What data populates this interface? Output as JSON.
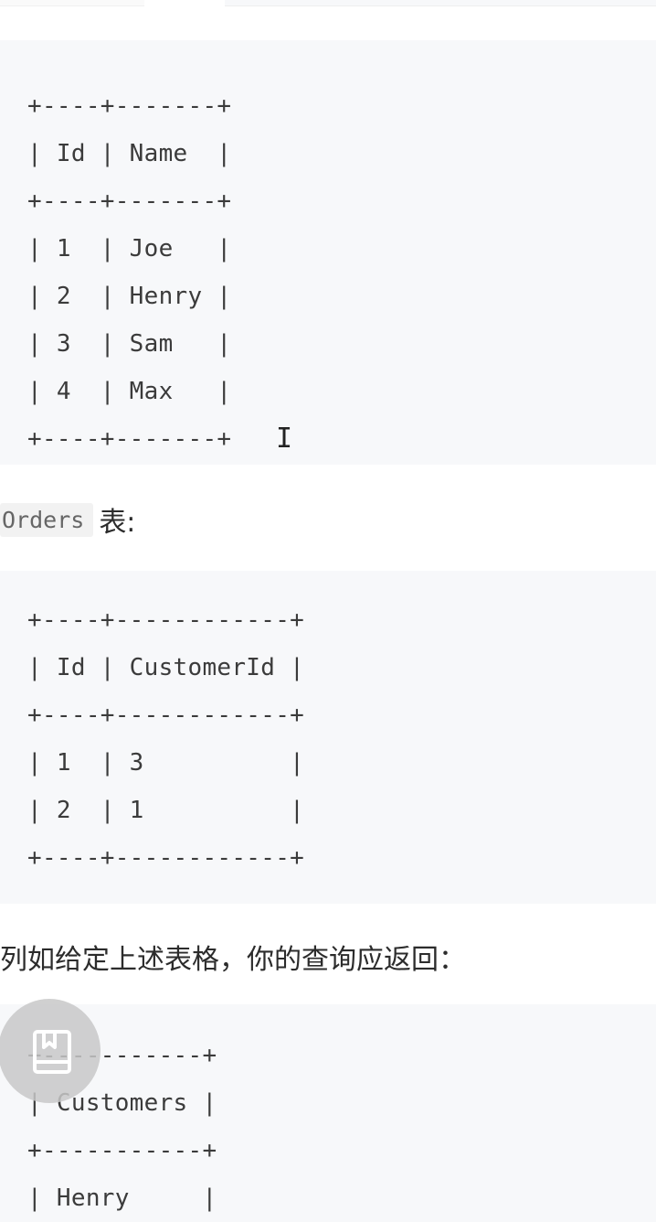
{
  "customers_table": {
    "lines": [
      "+----+-------+",
      "| Id | Name  |",
      "+----+-------+",
      "| 1  | Joe   |",
      "| 2  | Henry |",
      "| 3  | Sam   |",
      "| 4  | Max   |",
      "+----+-------+"
    ]
  },
  "orders_label": {
    "code": "Orders",
    "suffix": "表:"
  },
  "orders_table": {
    "lines": [
      "+----+------------+",
      "| Id | CustomerId |",
      "+----+------------+",
      "| 1  | 3          |",
      "| 2  | 1          |",
      "+----+------------+"
    ]
  },
  "example_text": "列如给定上述表格，你的查询应返回：",
  "result_table": {
    "lines": [
      "+-----------+",
      "| Customers |",
      "+-----------+",
      "| Henry     |"
    ]
  },
  "icons": {
    "cursor": "text-cursor-icon",
    "floating_button": "book-icon"
  }
}
